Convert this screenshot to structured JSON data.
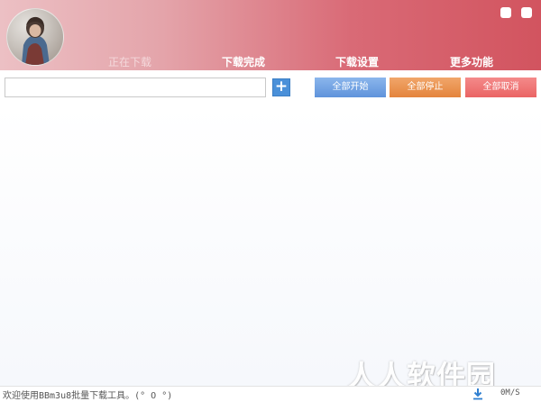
{
  "header": {
    "tabs": [
      {
        "label": "正在下载",
        "active": true
      },
      {
        "label": "下载完成",
        "active": false
      },
      {
        "label": "下载设置",
        "active": false
      },
      {
        "label": "更多功能",
        "active": false
      }
    ],
    "window_buttons": [
      "minimize",
      "close"
    ]
  },
  "toolbar": {
    "url_input": {
      "value": "",
      "placeholder": ""
    },
    "add_icon": "plus-icon",
    "start_all": "全部开始",
    "stop_all": "全部停止",
    "cancel_all": "全部取消"
  },
  "status": {
    "message": "欢迎使用BBm3u8批量下载工具。(° O °)",
    "download_icon": "download-arrow-icon",
    "speed": "0M/S"
  },
  "watermark": "人人软件园",
  "colors": {
    "header_start": "#ecc0c4",
    "header_end": "#d2545f",
    "start_button": "#6f9fe0",
    "stop_button": "#e8924f",
    "cancel_button": "#ef7474",
    "add_button": "#4a90d9"
  }
}
